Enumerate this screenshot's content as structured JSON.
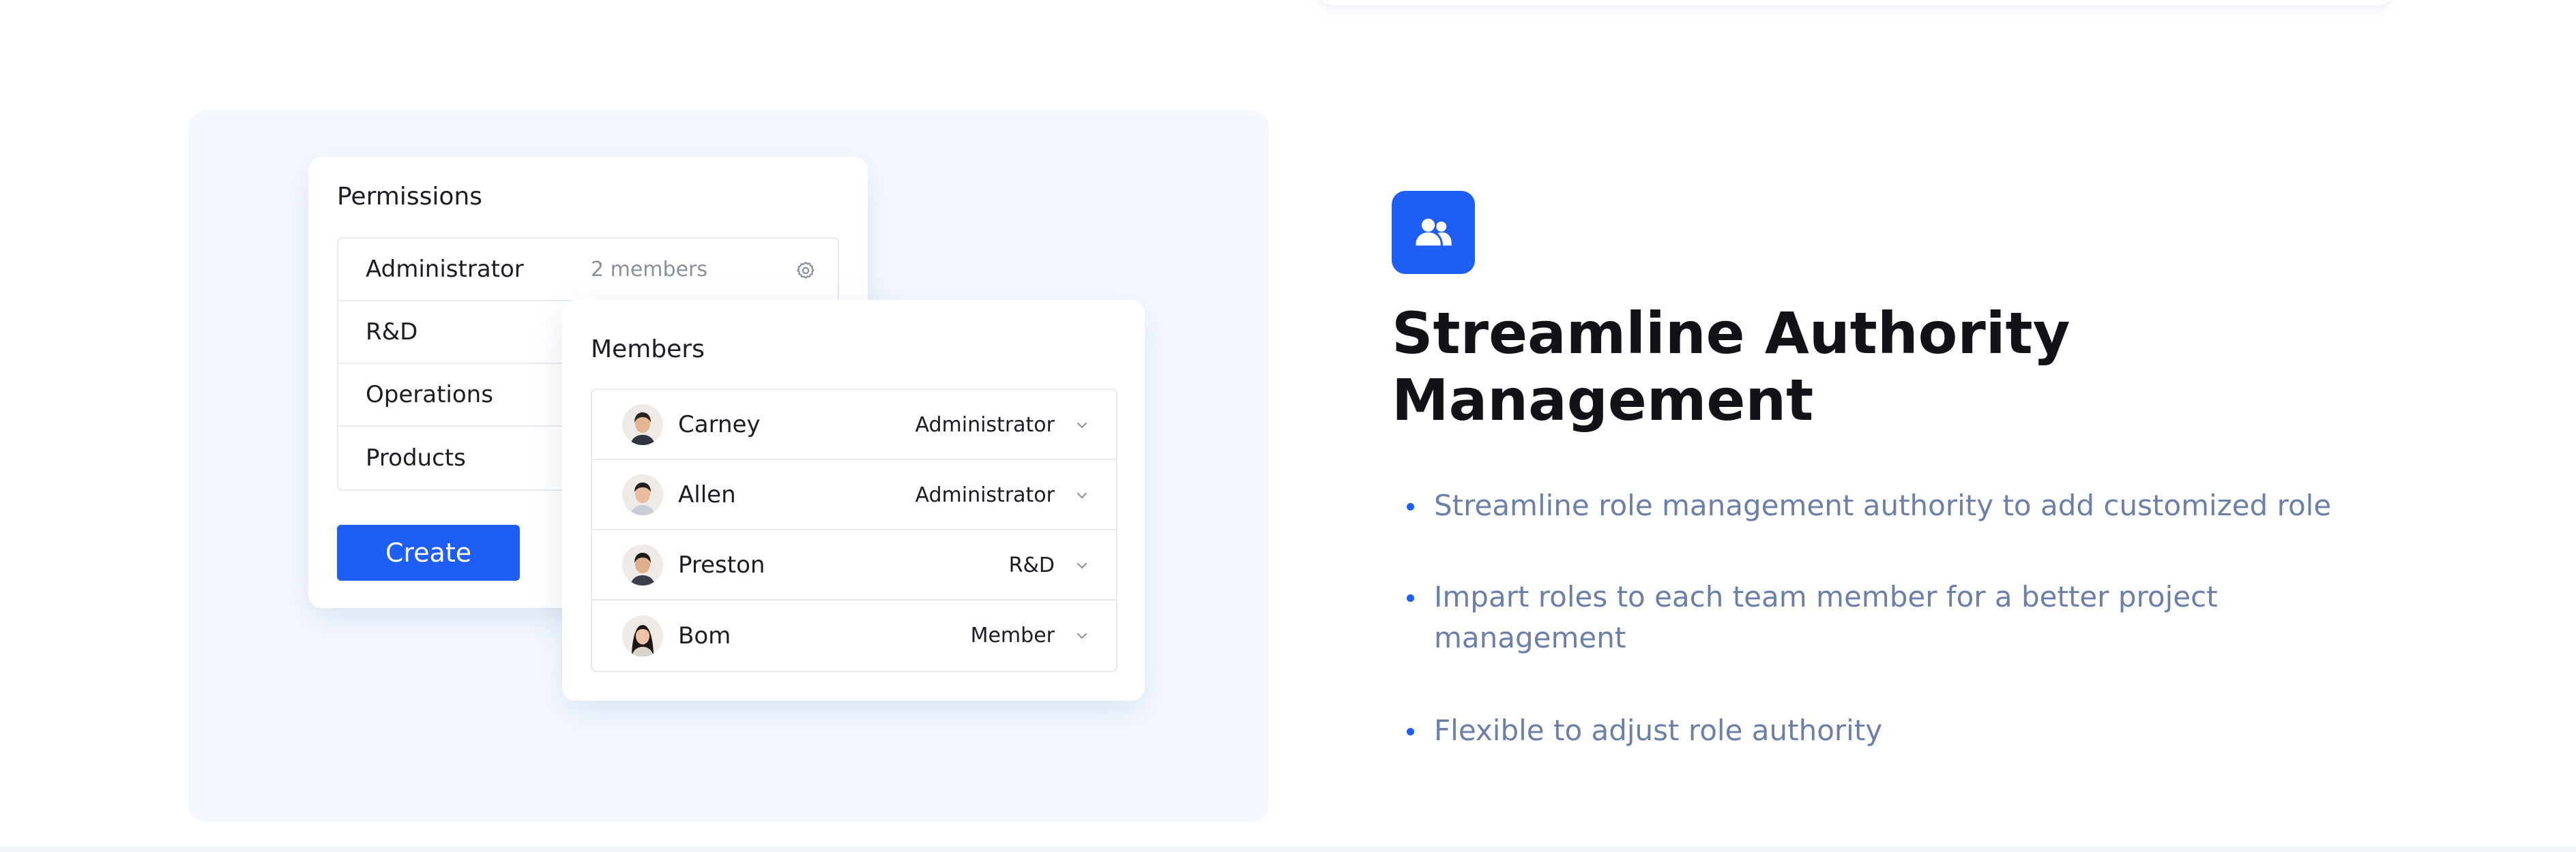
{
  "permissions": {
    "title": "Permissions",
    "roles": [
      {
        "name": "Administrator",
        "count": "2 members"
      },
      {
        "name": "R&D"
      },
      {
        "name": "Operations"
      },
      {
        "name": "Products"
      }
    ],
    "create_label": "Create"
  },
  "members": {
    "title": "Members",
    "list": [
      {
        "name": "Carney",
        "role": "Administrator"
      },
      {
        "name": "Allen",
        "role": "Administrator"
      },
      {
        "name": "Preston",
        "role": "R&D"
      },
      {
        "name": "Bom",
        "role": "Member"
      }
    ]
  },
  "feature": {
    "icon": "users-icon",
    "heading": "Streamline Authority Management",
    "bullets": [
      "Streamline role management authority to add customized role",
      "Impart roles to each team member for a better project management",
      "Flexible to adjust role authority"
    ]
  },
  "colors": {
    "accent": "#1f5ef5",
    "panel_background": "#f5f9ff",
    "bullet_text": "#6b7fa8"
  }
}
